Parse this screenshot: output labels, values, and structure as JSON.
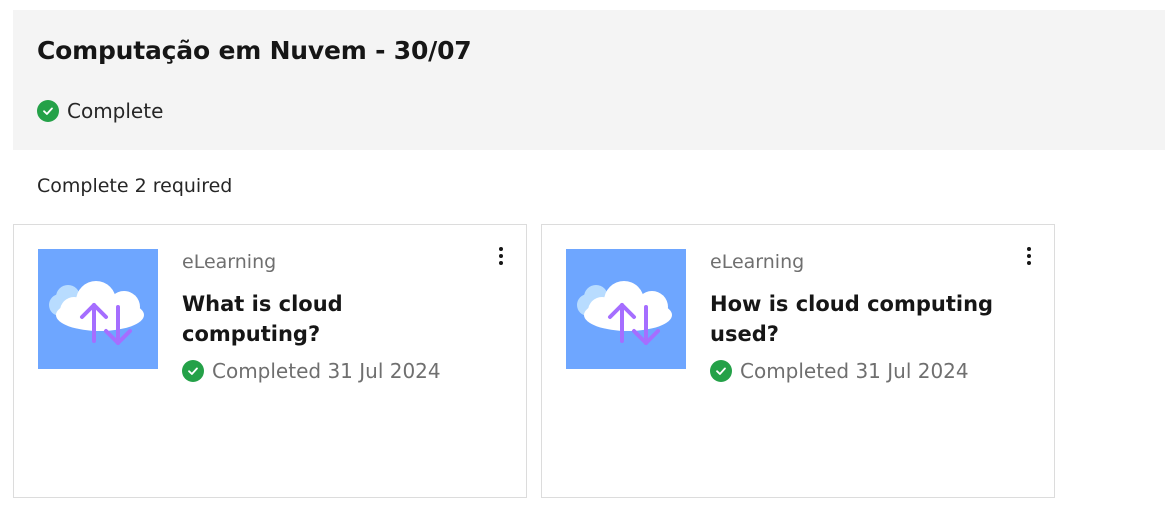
{
  "header": {
    "title": "Computação em Nuvem - 30/07",
    "status": "Complete"
  },
  "requirement": "Complete 2 required",
  "colors": {
    "success": "#24a148",
    "thumbnail": "#6ea6ff",
    "header_bg": "#f4f4f4"
  },
  "cards": [
    {
      "type": "eLearning",
      "title": "What is cloud computing?",
      "status": "Completed 31 Jul 2024",
      "icon": "cloud-transfer-icon"
    },
    {
      "type": "eLearning",
      "title": "How is cloud computing used?",
      "status": "Completed 31 Jul 2024",
      "icon": "cloud-transfer-icon"
    }
  ]
}
